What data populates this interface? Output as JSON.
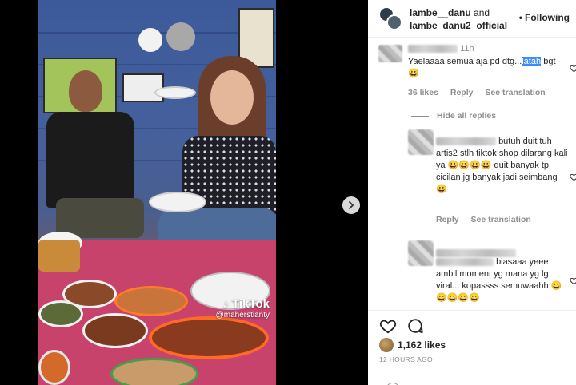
{
  "header": {
    "username_primary": "lambe__danu",
    "joiner": "and",
    "username_secondary": "lambe_danu2_official",
    "follow_dot": "•",
    "follow_label": "Following"
  },
  "video": {
    "watermark_brand": "TikTok",
    "watermark_user": "@maherstianty"
  },
  "comments": [
    {
      "time": "11h",
      "text_before_highlight": "Yaelaaaa semua aja pd dtg...",
      "text_highlight": "latah",
      "text_after_highlight": " bgt😀",
      "likes": "36 likes",
      "reply_label": "Reply",
      "translate_label": "See translation"
    }
  ],
  "hide_replies_label": "Hide all replies",
  "replies": [
    {
      "text_partial_mention_tail": "butuh duit tuh artis2 stlh tiktok shop dilarang kali ya 😀😀😀😀 duit banyak tp cicilan jg banyak jadi seimbang 😀",
      "reply_label": "Reply",
      "translate_label": "See translation"
    },
    {
      "text": "biasaaa yeee ambil moment yg mana yg lg viral... kopassss semuwaahh 😀😀😀😀😀"
    }
  ],
  "actions": {
    "likes_count": "1,162 likes",
    "posted_ago": "12 HOURS AGO"
  },
  "icons": {
    "like": "heart-icon",
    "comment": "comment-icon",
    "next": "chevron-right-icon"
  }
}
